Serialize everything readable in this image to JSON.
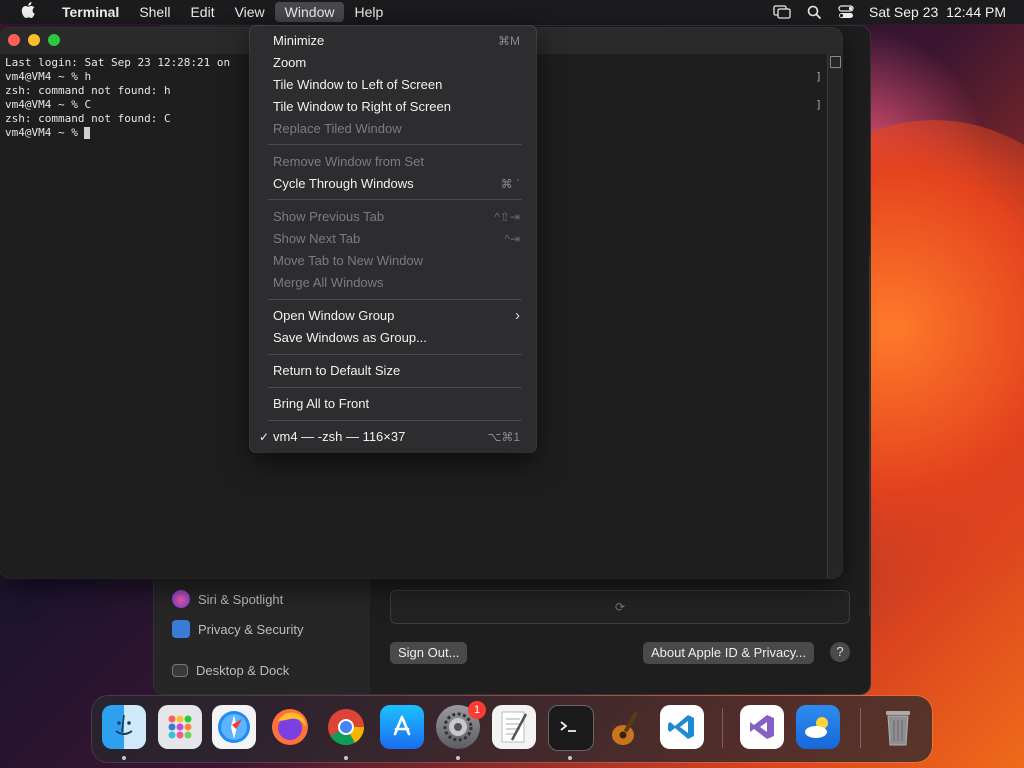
{
  "menubar": {
    "app_name": "Terminal",
    "menus": [
      "Shell",
      "Edit",
      "View",
      "Window",
      "Help"
    ],
    "datetime": "Sat Sep 23  12:44 PM"
  },
  "terminal": {
    "lines": [
      "Last login: Sat Sep 23 12:28:21 on",
      "vm4@VM4 ~ % h",
      "zsh: command not found: h",
      "vm4@VM4 ~ % C",
      "zsh: command not found: C",
      "vm4@VM4 ~ % "
    ]
  },
  "window_menu": {
    "items": [
      {
        "label": "Minimize",
        "shortcut": "⌘M",
        "enabled": true
      },
      {
        "label": "Zoom",
        "shortcut": "",
        "enabled": true
      },
      {
        "label": "Tile Window to Left of Screen",
        "shortcut": "",
        "enabled": true
      },
      {
        "label": "Tile Window to Right of Screen",
        "shortcut": "",
        "enabled": true
      },
      {
        "label": "Replace Tiled Window",
        "shortcut": "",
        "enabled": false
      },
      {
        "label": "Remove Window from Set",
        "shortcut": "",
        "enabled": false
      },
      {
        "label": "Cycle Through Windows",
        "shortcut": "⌘ `",
        "enabled": true
      },
      {
        "label": "Show Previous Tab",
        "shortcut": "^⇧⇥",
        "enabled": false
      },
      {
        "label": "Show Next Tab",
        "shortcut": "^⇥",
        "enabled": false
      },
      {
        "label": "Move Tab to New Window",
        "shortcut": "",
        "enabled": false
      },
      {
        "label": "Merge All Windows",
        "shortcut": "",
        "enabled": false
      },
      {
        "label": "Open Window Group",
        "shortcut": "›",
        "enabled": true
      },
      {
        "label": "Save Windows as Group...",
        "shortcut": "",
        "enabled": true
      },
      {
        "label": "Return to Default Size",
        "shortcut": "",
        "enabled": true
      },
      {
        "label": "Bring All to Front",
        "shortcut": "",
        "enabled": true
      },
      {
        "label": "vm4 — -zsh — 116×37",
        "shortcut": "⌥⌘1",
        "enabled": true,
        "checked": "✓"
      }
    ]
  },
  "settings": {
    "sidebar": [
      {
        "label": "Siri & Spotlight",
        "color": "#c04cd8"
      },
      {
        "label": "Privacy & Security",
        "color": "#3b7bd8"
      },
      {
        "label": "Desktop & Dock",
        "color": "#3a3a3a"
      }
    ],
    "sign_out": "Sign Out...",
    "about": "About Apple ID & Privacy...",
    "help": "?"
  },
  "dock": {
    "badge": "1"
  }
}
